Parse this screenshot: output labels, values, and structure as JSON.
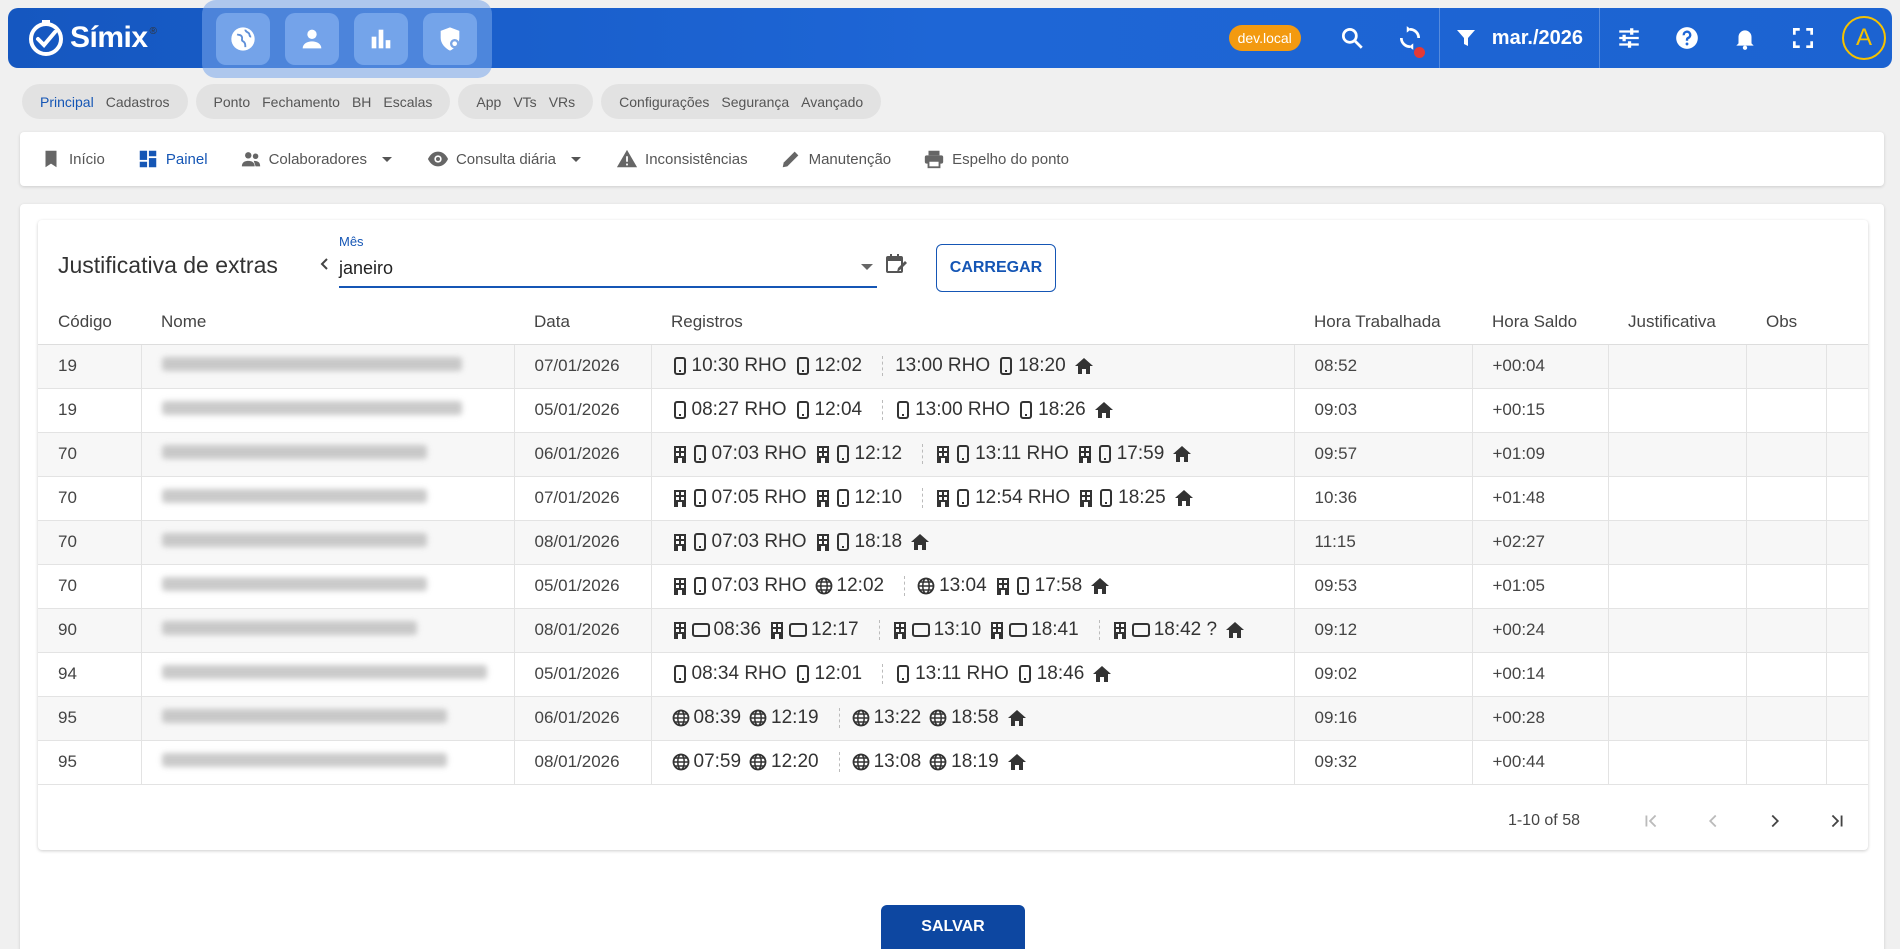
{
  "app": {
    "name": "Símix",
    "reg": "®",
    "env_badge": "dev.local",
    "period_filter": "mar./2026",
    "avatar_letter": "A"
  },
  "quick_actions": [
    "globe-icon",
    "person-icon",
    "bar-chart-icon",
    "shield-icon"
  ],
  "chip_groups": [
    {
      "items": [
        "Principal",
        "Cadastros"
      ],
      "active": "Principal"
    },
    {
      "items": [
        "Ponto",
        "Fechamento",
        "BH",
        "Escalas"
      ]
    },
    {
      "items": [
        "App",
        "VTs",
        "VRs"
      ]
    },
    {
      "items": [
        "Configurações",
        "Segurança",
        "Avançado"
      ]
    }
  ],
  "nav": {
    "inicio": "Início",
    "painel": "Painel",
    "colaboradores": "Colaboradores",
    "consulta": "Consulta diária",
    "inconsistencias": "Inconsistências",
    "manutencao": "Manutenção",
    "espelho": "Espelho do ponto"
  },
  "page": {
    "title": "Justificativa de extras",
    "month_label": "Mês",
    "month_value": "janeiro",
    "load_button": "CARREGAR",
    "save_button": "SALVAR"
  },
  "table": {
    "columns": [
      "Código",
      "Nome",
      "Data",
      "Registros",
      "Hora Trabalhada",
      "Hora Saldo",
      "Justificativa",
      "Obs"
    ],
    "rows": [
      {
        "codigo": "19",
        "data": "07/01/2026",
        "trabalhada": "08:52",
        "saldo": "+00:04",
        "registros": [
          [
            [
              "phone",
              "10:30 RHO"
            ],
            [
              "phone",
              "12:02"
            ]
          ],
          [
            [
              "none",
              "13:00 RHO"
            ],
            [
              "phone",
              "18:20"
            ]
          ]
        ]
      },
      {
        "codigo": "19",
        "data": "05/01/2026",
        "trabalhada": "09:03",
        "saldo": "+00:15",
        "registros": [
          [
            [
              "phone",
              "08:27 RHO"
            ],
            [
              "phone",
              "12:04"
            ]
          ],
          [
            [
              "phone",
              "13:00 RHO"
            ],
            [
              "phone",
              "18:26"
            ]
          ]
        ]
      },
      {
        "codigo": "70",
        "data": "06/01/2026",
        "trabalhada": "09:57",
        "saldo": "+01:09",
        "registros": [
          [
            [
              "bphone",
              "07:03 RHO"
            ],
            [
              "bphone",
              "12:12"
            ]
          ],
          [
            [
              "bphone",
              "13:11 RHO"
            ],
            [
              "bphone",
              "17:59"
            ]
          ]
        ]
      },
      {
        "codigo": "70",
        "data": "07/01/2026",
        "trabalhada": "10:36",
        "saldo": "+01:48",
        "registros": [
          [
            [
              "bphone",
              "07:05 RHO"
            ],
            [
              "bphone",
              "12:10"
            ]
          ],
          [
            [
              "bphone",
              "12:54 RHO"
            ],
            [
              "bphone",
              "18:25"
            ]
          ]
        ]
      },
      {
        "codigo": "70",
        "data": "08/01/2026",
        "trabalhada": "11:15",
        "saldo": "+02:27",
        "registros": [
          [
            [
              "bphone",
              "07:03 RHO"
            ],
            [
              "bphone",
              "18:18"
            ]
          ]
        ]
      },
      {
        "codigo": "70",
        "data": "05/01/2026",
        "trabalhada": "09:53",
        "saldo": "+01:05",
        "registros": [
          [
            [
              "bphone",
              "07:03 RHO"
            ],
            [
              "globe",
              "12:02"
            ]
          ],
          [
            [
              "globe",
              "13:04"
            ],
            [
              "bphone",
              "17:58"
            ]
          ]
        ]
      },
      {
        "codigo": "90",
        "data": "08/01/2026",
        "trabalhada": "09:12",
        "saldo": "+00:24",
        "registros": [
          [
            [
              "btablet",
              "08:36"
            ],
            [
              "btablet",
              "12:17"
            ]
          ],
          [
            [
              "btablet",
              "13:10"
            ],
            [
              "btablet",
              "18:41"
            ]
          ],
          [
            [
              "btablet",
              "18:42 ?"
            ]
          ]
        ]
      },
      {
        "codigo": "94",
        "data": "05/01/2026",
        "trabalhada": "09:02",
        "saldo": "+00:14",
        "registros": [
          [
            [
              "phone",
              "08:34 RHO"
            ],
            [
              "phone",
              "12:01"
            ]
          ],
          [
            [
              "phone",
              "13:11 RHO"
            ],
            [
              "phone",
              "18:46"
            ]
          ]
        ]
      },
      {
        "codigo": "95",
        "data": "06/01/2026",
        "trabalhada": "09:16",
        "saldo": "+00:28",
        "registros": [
          [
            [
              "globe",
              "08:39"
            ],
            [
              "globe",
              "12:19"
            ]
          ],
          [
            [
              "globe",
              "13:22"
            ],
            [
              "globe",
              "18:58"
            ]
          ]
        ]
      },
      {
        "codigo": "95",
        "data": "08/01/2026",
        "trabalhada": "09:32",
        "saldo": "+00:44",
        "registros": [
          [
            [
              "globe",
              "07:59"
            ],
            [
              "globe",
              "12:20"
            ]
          ],
          [
            [
              "globe",
              "13:08"
            ],
            [
              "globe",
              "18:19"
            ]
          ]
        ]
      }
    ]
  },
  "pagination": {
    "range": "1-10 of 58"
  },
  "colors": {
    "primary": "#1556b5",
    "topbar": "#1e66d6",
    "badge": "#f39a10",
    "avatar_ring": "#f6c200"
  }
}
